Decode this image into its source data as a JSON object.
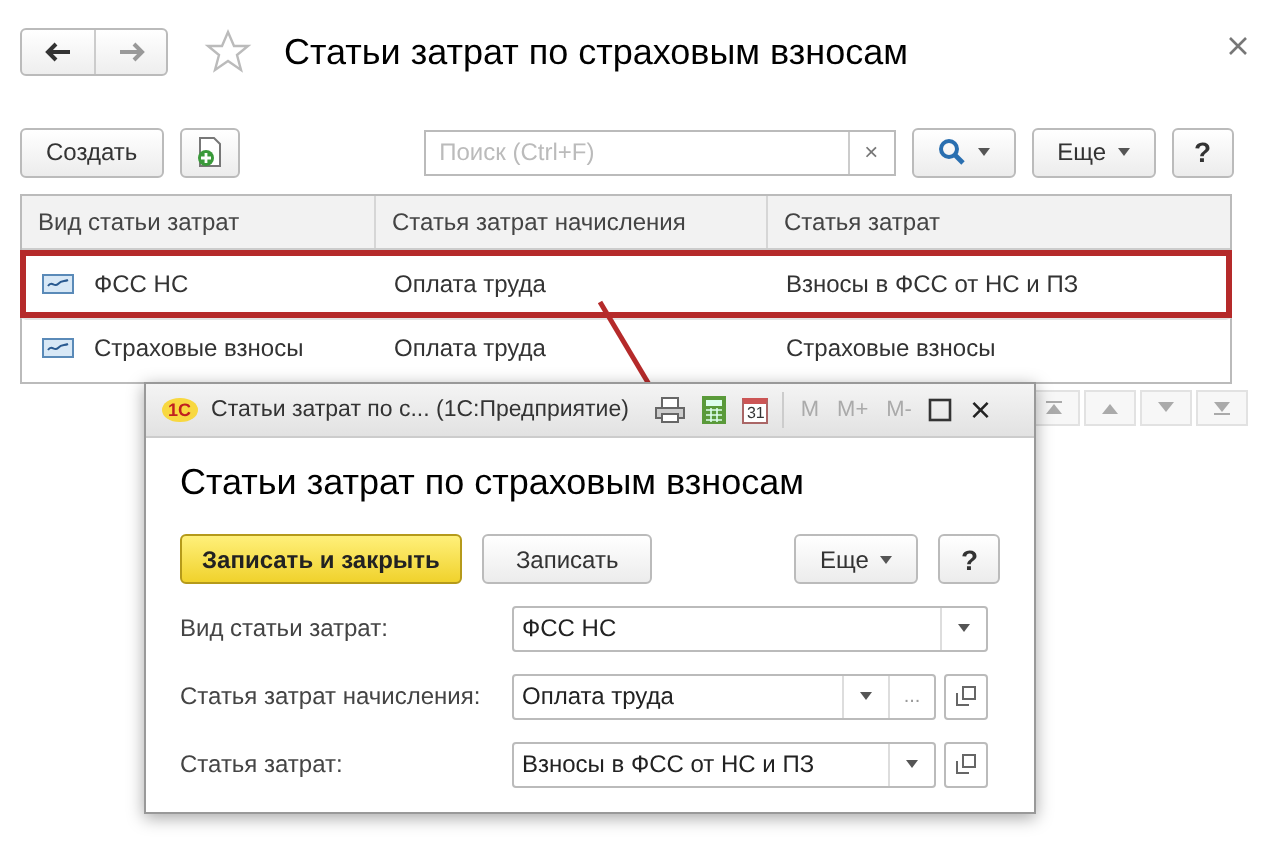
{
  "window": {
    "title": "Статьи затрат по страховым взносам",
    "favorite": false
  },
  "toolbar": {
    "create_button": "Создать",
    "search": {
      "placeholder": "Поиск (Ctrl+F)",
      "clear": "×"
    },
    "more_button": "Еще",
    "help_button": "?"
  },
  "table": {
    "columns": [
      "Вид статьи затрат",
      "Статья затрат начисления",
      "Статья затрат"
    ],
    "rows": [
      {
        "cells": [
          "ФСС НС",
          "Оплата труда",
          "Взносы в ФСС от НС и ПЗ"
        ],
        "selected": true
      },
      {
        "cells": [
          "Страховые взносы",
          "Оплата труда",
          "Страховые взносы"
        ],
        "selected": false
      }
    ]
  },
  "dialog": {
    "logo": "1С",
    "caption": "Статьи затрат по с...  (1С:Предприятие)",
    "calendar_day": "31",
    "memory_buttons": [
      "M",
      "M+",
      "M-"
    ],
    "close": "×",
    "title": "Статьи затрат по страховым взносам",
    "buttons": {
      "primary": "Записать и закрыть",
      "save": "Записать",
      "more": "Еще",
      "help": "?"
    },
    "fields": [
      {
        "label": "Вид статьи затрат:",
        "value": "ФСС НС",
        "open": false
      },
      {
        "label": "Статья затрат начисления:",
        "value": "Оплата труда",
        "choice": "...",
        "open": true
      },
      {
        "label": "Статья затрат:",
        "value": "Взносы в ФСС от НС и ПЗ",
        "open": true
      }
    ]
  }
}
